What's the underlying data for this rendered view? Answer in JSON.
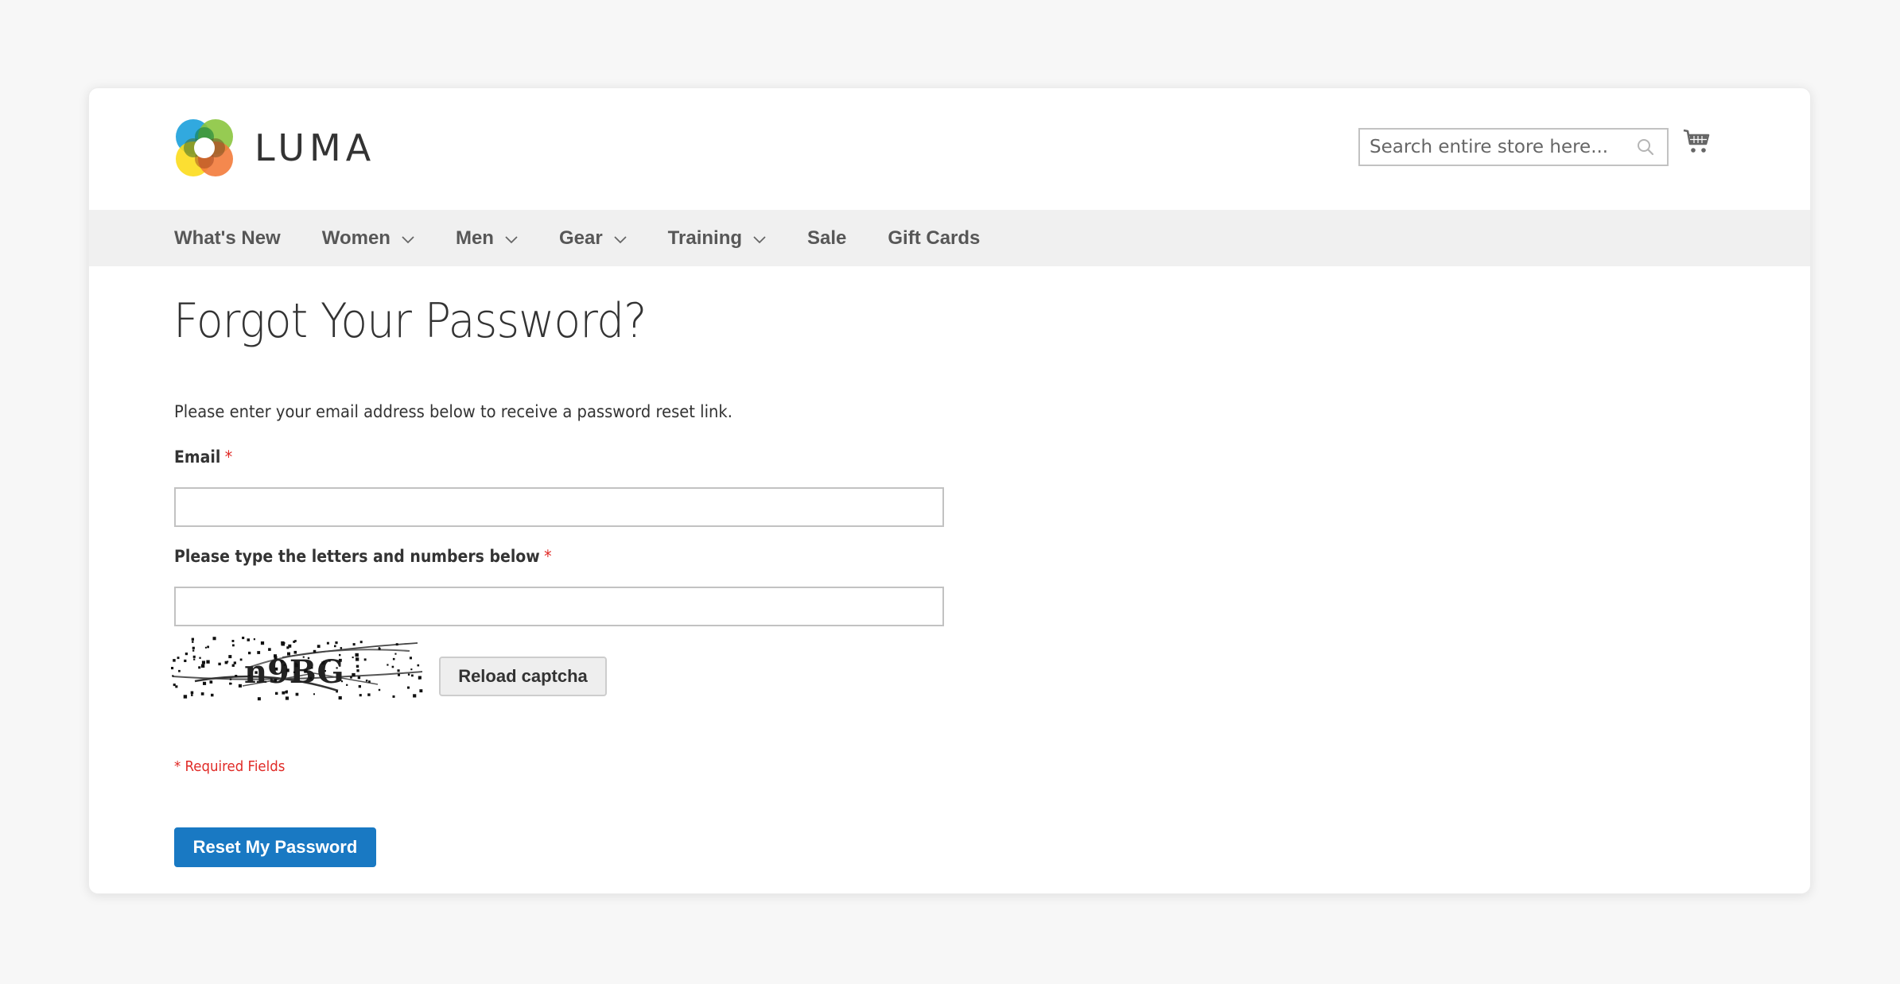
{
  "header": {
    "logo_text": "LUMA",
    "search": {
      "placeholder": "Search entire store here...",
      "value": ""
    },
    "icons": {
      "search": "search-icon",
      "cart": "cart-icon",
      "logo": "luma-logo-icon"
    }
  },
  "nav": {
    "items": [
      {
        "label": "What's New",
        "has_dropdown": false
      },
      {
        "label": "Women",
        "has_dropdown": true
      },
      {
        "label": "Men",
        "has_dropdown": true
      },
      {
        "label": "Gear",
        "has_dropdown": true
      },
      {
        "label": "Training",
        "has_dropdown": true
      },
      {
        "label": "Sale",
        "has_dropdown": false
      },
      {
        "label": "Gift Cards",
        "has_dropdown": false
      }
    ]
  },
  "page": {
    "title": "Forgot Your Password?",
    "intro": "Please enter your email address below to receive a password reset link.",
    "form": {
      "email": {
        "label": "Email",
        "required_mark": "*",
        "value": "",
        "placeholder": ""
      },
      "captcha": {
        "label": "Please type the letters and numbers below",
        "required_mark": "*",
        "value": "",
        "placeholder": "",
        "image_text": "n9BG"
      },
      "reload_label": "Reload captcha",
      "required_note": "* Required Fields",
      "submit_label": "Reset My Password"
    }
  },
  "colors": {
    "primary_button": "#1979c3",
    "required": "#e02b27",
    "nav_background": "#f0f0f0",
    "page_background": "#f7f7f7"
  }
}
